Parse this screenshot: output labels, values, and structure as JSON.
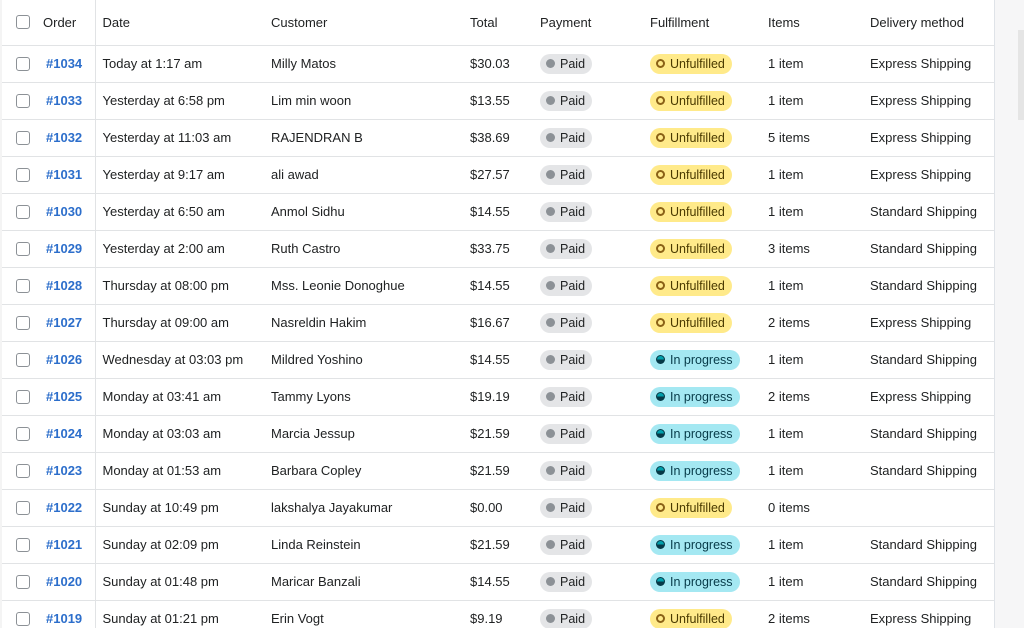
{
  "table": {
    "headers": {
      "order": "Order",
      "date": "Date",
      "customer": "Customer",
      "total": "Total",
      "payment": "Payment",
      "fulfillment": "Fulfillment",
      "items": "Items",
      "delivery": "Delivery method"
    },
    "rows": [
      {
        "order": "#1034",
        "date": "Today at 1:17 am",
        "customer": "Milly Matos",
        "total": "$30.03",
        "payment": "Paid",
        "fulfillment": "Unfulfilled",
        "items": "1 item",
        "delivery": "Express Shipping"
      },
      {
        "order": "#1033",
        "date": "Yesterday at 6:58 pm",
        "customer": "Lim min woon",
        "total": "$13.55",
        "payment": "Paid",
        "fulfillment": "Unfulfilled",
        "items": "1 item",
        "delivery": "Express Shipping"
      },
      {
        "order": "#1032",
        "date": "Yesterday at 11:03 am",
        "customer": "RAJENDRAN B",
        "total": "$38.69",
        "payment": "Paid",
        "fulfillment": "Unfulfilled",
        "items": "5 items",
        "delivery": "Express Shipping"
      },
      {
        "order": "#1031",
        "date": "Yesterday at 9:17 am",
        "customer": "ali awad",
        "total": "$27.57",
        "payment": "Paid",
        "fulfillment": "Unfulfilled",
        "items": "1 item",
        "delivery": "Express Shipping"
      },
      {
        "order": "#1030",
        "date": "Yesterday at 6:50 am",
        "customer": "Anmol Sidhu",
        "total": "$14.55",
        "payment": "Paid",
        "fulfillment": "Unfulfilled",
        "items": "1 item",
        "delivery": "Standard Shipping"
      },
      {
        "order": "#1029",
        "date": "Yesterday at 2:00 am",
        "customer": "Ruth Castro",
        "total": "$33.75",
        "payment": "Paid",
        "fulfillment": "Unfulfilled",
        "items": "3 items",
        "delivery": "Standard Shipping"
      },
      {
        "order": "#1028",
        "date": "Thursday at 08:00 pm",
        "customer": "Mss. Leonie Donoghue",
        "total": "$14.55",
        "payment": "Paid",
        "fulfillment": "Unfulfilled",
        "items": "1 item",
        "delivery": "Standard Shipping"
      },
      {
        "order": "#1027",
        "date": "Thursday at 09:00 am",
        "customer": "Nasreldin Hakim",
        "total": "$16.67",
        "payment": "Paid",
        "fulfillment": "Unfulfilled",
        "items": "2 items",
        "delivery": "Express Shipping"
      },
      {
        "order": "#1026",
        "date": "Wednesday at 03:03 pm",
        "customer": "Mildred Yoshino",
        "total": "$14.55",
        "payment": "Paid",
        "fulfillment": "In progress",
        "items": "1 item",
        "delivery": "Standard Shipping"
      },
      {
        "order": "#1025",
        "date": "Monday at 03:41 am",
        "customer": "Tammy Lyons",
        "total": "$19.19",
        "payment": "Paid",
        "fulfillment": "In progress",
        "items": "2 items",
        "delivery": "Express Shipping"
      },
      {
        "order": "#1024",
        "date": "Monday at 03:03 am",
        "customer": "Marcia Jessup",
        "total": "$21.59",
        "payment": "Paid",
        "fulfillment": "In progress",
        "items": "1 item",
        "delivery": "Standard Shipping"
      },
      {
        "order": "#1023",
        "date": "Monday at 01:53 am",
        "customer": "Barbara Copley",
        "total": "$21.59",
        "payment": "Paid",
        "fulfillment": "In progress",
        "items": "1 item",
        "delivery": "Standard Shipping"
      },
      {
        "order": "#1022",
        "date": "Sunday at 10:49 pm",
        "customer": "lakshalya Jayakumar",
        "total": "$0.00",
        "payment": "Paid",
        "fulfillment": "Unfulfilled",
        "items": "0 items",
        "delivery": ""
      },
      {
        "order": "#1021",
        "date": "Sunday at 02:09 pm",
        "customer": "Linda Reinstein",
        "total": "$21.59",
        "payment": "Paid",
        "fulfillment": "In progress",
        "items": "1 item",
        "delivery": "Standard Shipping"
      },
      {
        "order": "#1020",
        "date": "Sunday at 01:48 pm",
        "customer": "Maricar Banzali",
        "total": "$14.55",
        "payment": "Paid",
        "fulfillment": "In progress",
        "items": "1 item",
        "delivery": "Standard Shipping"
      },
      {
        "order": "#1019",
        "date": "Sunday at 01:21 pm",
        "customer": "Erin Vogt",
        "total": "$9.19",
        "payment": "Paid",
        "fulfillment": "Unfulfilled",
        "items": "2 items",
        "delivery": "Express Shipping"
      }
    ]
  },
  "colors": {
    "link": "#2c6ecb",
    "paid_badge": "#e4e5e7",
    "unfulfilled_badge": "#ffea8a",
    "in_progress_badge": "#a4e8f2"
  },
  "icons": {
    "paid": "filled-gray-dot-icon",
    "unfulfilled": "hollow-ring-icon",
    "in_progress": "half-filled-circle-icon"
  }
}
